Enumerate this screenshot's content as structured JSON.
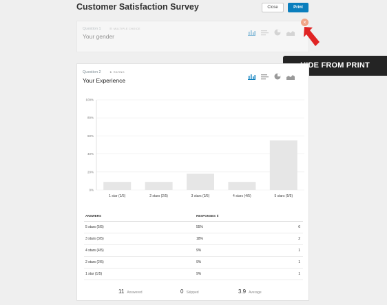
{
  "header": {
    "title": "Customer Satisfaction Survey",
    "close_label": "Close",
    "print_label": "Print"
  },
  "question1": {
    "number": "Question 1",
    "type": "MULTIPLE CHOICE",
    "title": "Your gender",
    "hide_icon": "close-icon"
  },
  "hide_banner": {
    "label": "HIDE FROM PRINT"
  },
  "question2": {
    "number": "Question 2",
    "type": "RATING",
    "title": "Your Experience"
  },
  "table": {
    "col_answers": "ANSWERS",
    "col_responses": "RESPONSES",
    "rows": [
      {
        "answer": "5 stars (5/5)",
        "percent": "55%",
        "count": "6"
      },
      {
        "answer": "3 stars (3/5)",
        "percent": "18%",
        "count": "2"
      },
      {
        "answer": "4 stars (4/5)",
        "percent": "9%",
        "count": "1"
      },
      {
        "answer": "2 stars (2/5)",
        "percent": "9%",
        "count": "1"
      },
      {
        "answer": "1 star (1/5)",
        "percent": "9%",
        "count": "1"
      }
    ]
  },
  "summary": {
    "answered": "11",
    "answered_label": "Answered",
    "skipped": "0",
    "skipped_label": "Skipped",
    "average": "3.9",
    "average_label": "Average"
  },
  "chart_data": {
    "type": "bar",
    "categories": [
      "1 star (1/5)",
      "2 stars (2/5)",
      "3 stars (3/5)",
      "4 stars (4/5)",
      "5 stars (5/5)"
    ],
    "values": [
      9,
      9,
      18,
      9,
      55
    ],
    "ylim": [
      0,
      100
    ],
    "yticks": [
      "0%",
      "20%",
      "40%",
      "60%",
      "80%",
      "100%"
    ],
    "grid": true,
    "colors": {
      "bar": "#e6e6e6",
      "grid": "#e9e9e9",
      "active_icon": "#0a7ebd",
      "inactive_icon": "#c8c8c8"
    }
  }
}
